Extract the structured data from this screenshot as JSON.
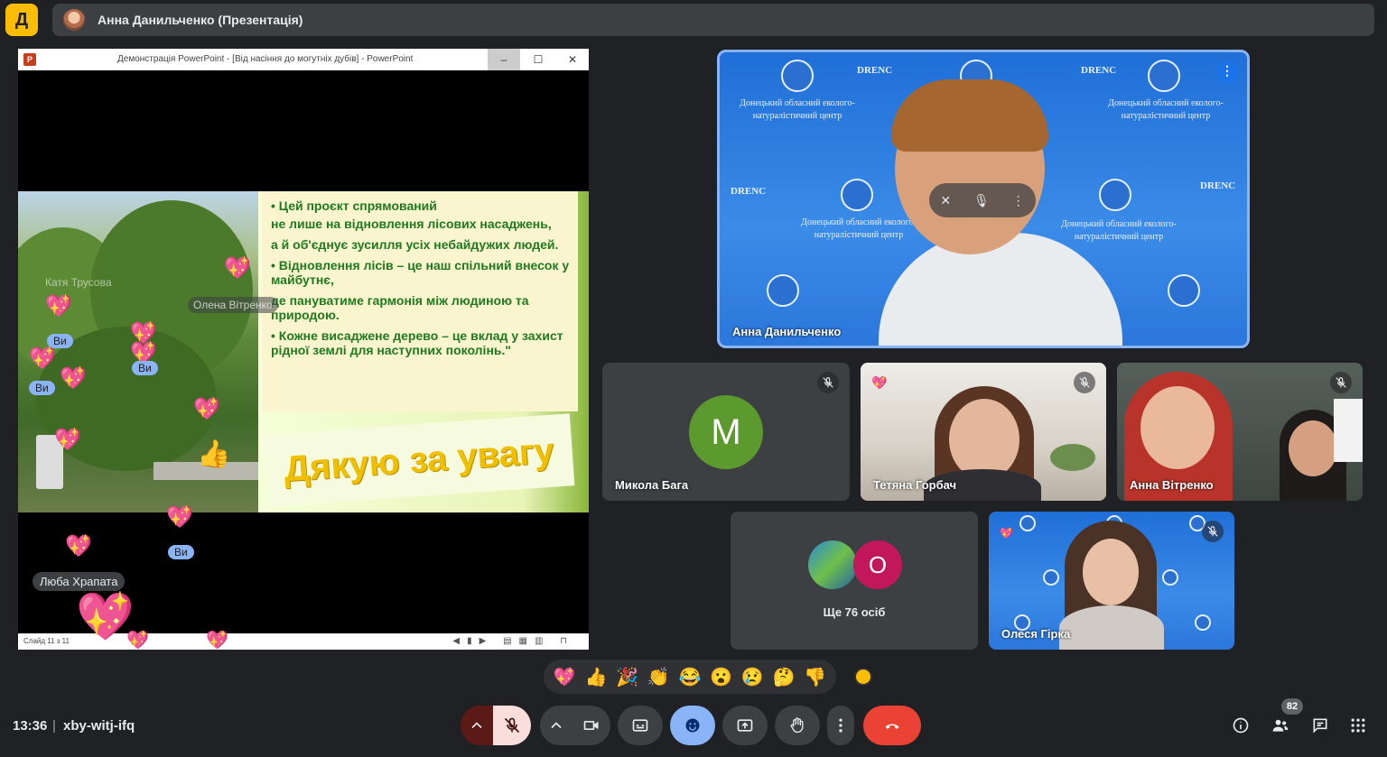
{
  "presentation_banner": {
    "title": "Анна Данильченко (Презентація)"
  },
  "ppt_window": {
    "title": "Демонстрація PowerPoint - [Від насіння до могутніх дубів] - PowerPoint",
    "logo": "P",
    "status": "Слайд 11 з 11",
    "buttons": {
      "minimize": "–",
      "maximize": "☐",
      "close": "✕"
    }
  },
  "slide": {
    "bullets": [
      "• Цей проєкт спрямований",
      "не лише на відновлення лісових насаджень,",
      "а й об'єднує зусилля усіх небайдужих людей.",
      "• Відновлення лісів – це наш спільний внесок у майбутнє,",
      "де пануватиме гармонія між людиною та природою.",
      "• Кожне висаджене дерево – це вклад у захист рідної землі для наступних поколінь.\""
    ],
    "thanks": "Дякую за увагу"
  },
  "overlay": {
    "ghost_name_1": "Катя Трусова",
    "ghost_name_2": "Олена Вітренко",
    "you_label": "Ви",
    "reactor_name": "Люба Храпата"
  },
  "participants": {
    "main": {
      "name": "Анна Данильченко",
      "more": "⋮"
    },
    "mykola": {
      "name": "Микола Бага",
      "initial": "M"
    },
    "tetyana": {
      "name": "Тетяна Горбач"
    },
    "anna_v": {
      "name": "Анна Вітренко"
    },
    "more": {
      "label": "Ще 76 осіб",
      "initial": "O"
    },
    "olesya": {
      "name": "Олеся Гірка"
    }
  },
  "background_texts": {
    "drenc": "DRENC",
    "org": "Донецький обласний еколого-натуралістичний центр"
  },
  "reactions": [
    "💖",
    "👍",
    "🎉",
    "👏",
    "😂",
    "😮",
    "😢",
    "🤔",
    "👎"
  ],
  "meeting": {
    "time": "13:36",
    "code": "xby-witj-ifq",
    "participants_count": "82"
  },
  "colors": {
    "accent": "#8ab4f8",
    "end_call": "#ea4335",
    "active_control": "#8ab4f8",
    "mic_off": "#f9dedc"
  }
}
